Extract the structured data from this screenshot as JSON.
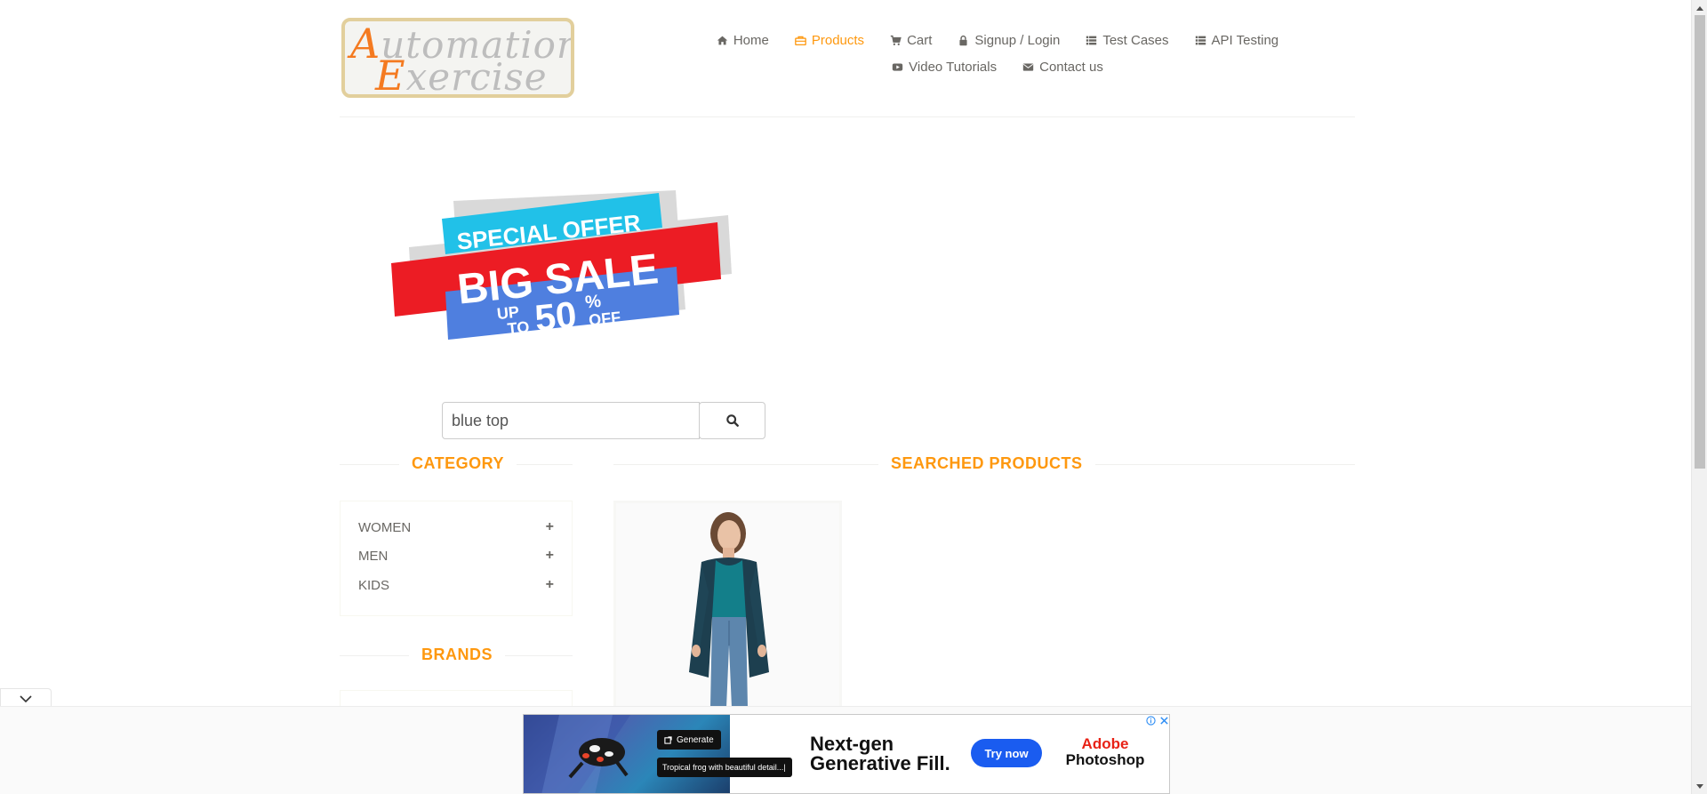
{
  "logo": {
    "line1_cap": "A",
    "line1_rest": "utomation",
    "line2_cap": "E",
    "line2_rest": "xercise"
  },
  "nav": {
    "items": [
      {
        "label": "Home",
        "icon": "home-icon"
      },
      {
        "label": "Products",
        "icon": "products-icon",
        "active": true
      },
      {
        "label": "Cart",
        "icon": "cart-icon"
      },
      {
        "label": "Signup / Login",
        "icon": "lock-icon"
      },
      {
        "label": "Test Cases",
        "icon": "list-icon"
      },
      {
        "label": "API Testing",
        "icon": "list-icon"
      },
      {
        "label": "Video Tutorials",
        "icon": "youtube-icon"
      },
      {
        "label": "Contact us",
        "icon": "envelope-icon"
      }
    ]
  },
  "sale_banner": {
    "line1": "SPECIAL OFFER",
    "line2": "BIG SALE",
    "line3_up": "UP",
    "line3_to": "TO",
    "line3_num": "50",
    "line3_pct": "%",
    "line3_off": "OFF"
  },
  "search": {
    "value": "blue top",
    "icon": "search-icon"
  },
  "category": {
    "title": "CATEGORY",
    "items": [
      {
        "label": "WOMEN"
      },
      {
        "label": "MEN"
      },
      {
        "label": "KIDS"
      }
    ],
    "expand_symbol": "+"
  },
  "brands": {
    "title": "BRANDS"
  },
  "products": {
    "title": "SEARCHED PRODUCTS"
  },
  "ad": {
    "generate_label": "Generate",
    "prompt_text": "Tropical frog with beautiful detail...|",
    "headline_1": "Next-gen",
    "headline_2": "Generative Fill.",
    "cta": "Try now",
    "brand_1": "Adobe",
    "brand_2": "Photoshop"
  },
  "colors": {
    "accent": "#fe980f",
    "text": "#696763",
    "ad_button": "#1a5cf0",
    "adobe_red": "#e82216"
  }
}
